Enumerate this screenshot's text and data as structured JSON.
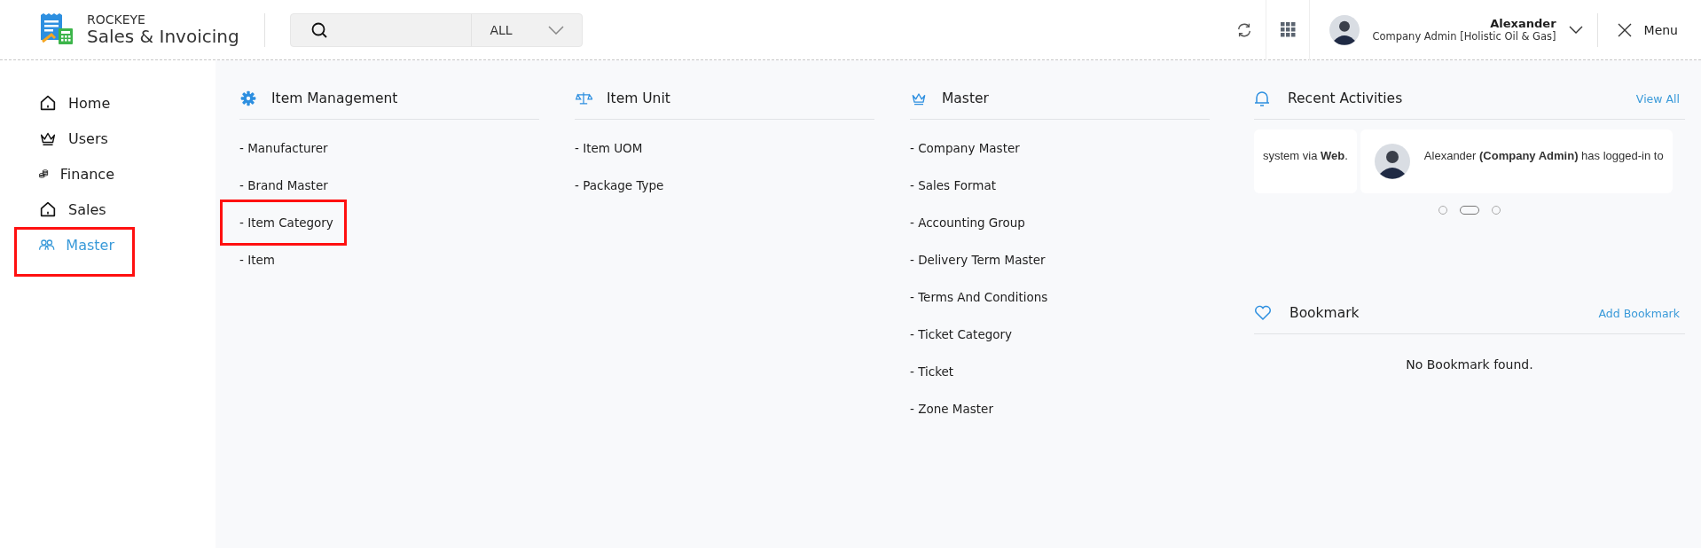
{
  "app": {
    "brand": "ROCKEYE",
    "title": "Sales & Invoicing"
  },
  "search": {
    "filter": "ALL"
  },
  "user": {
    "name": "Alexander",
    "role": "Company Admin [Holistic Oil & Gas]"
  },
  "menu_button": {
    "label": "Menu"
  },
  "sidebar": {
    "items": [
      {
        "label": "Home",
        "kind": "house",
        "selected": false,
        "highlighted": false
      },
      {
        "label": "Users",
        "kind": "crown",
        "selected": false,
        "highlighted": false
      },
      {
        "label": "Finance",
        "kind": "coins",
        "selected": false,
        "highlighted": false
      },
      {
        "label": "Sales",
        "kind": "house",
        "selected": false,
        "highlighted": false
      },
      {
        "label": "Master",
        "kind": "people",
        "selected": true,
        "highlighted": true
      }
    ]
  },
  "sections": [
    {
      "title": "Item Management",
      "kind": "gear",
      "links": [
        {
          "label": "- Manufacturer",
          "highlighted": false
        },
        {
          "label": "- Brand Master",
          "highlighted": false
        },
        {
          "label": "- Item Category",
          "highlighted": true
        },
        {
          "label": "- Item",
          "highlighted": false
        }
      ]
    },
    {
      "title": "Item Unit",
      "kind": "scale",
      "links": [
        {
          "label": "- Item UOM",
          "highlighted": false
        },
        {
          "label": "- Package Type",
          "highlighted": false
        }
      ]
    },
    {
      "title": "Master",
      "kind": "crown",
      "links": [
        {
          "label": "- Company Master",
          "highlighted": false
        },
        {
          "label": "- Sales Format",
          "highlighted": false
        },
        {
          "label": "- Accounting Group",
          "highlighted": false
        },
        {
          "label": "- Delivery Term Master",
          "highlighted": false
        },
        {
          "label": "- Terms And Conditions",
          "highlighted": false
        },
        {
          "label": "- Ticket Category",
          "highlighted": false
        },
        {
          "label": "- Ticket",
          "highlighted": false
        },
        {
          "label": "- Zone Master",
          "highlighted": false
        }
      ]
    }
  ],
  "recent_activities": {
    "title": "Recent Activities",
    "action": "View All",
    "cards": [
      {
        "text": "system via **Web**.",
        "avatar": false
      },
      {
        "text": "Alexander **(Company Admin)** has logged-in to",
        "avatar": true
      }
    ],
    "dots": [
      {
        "selected": false
      },
      {
        "selected": true
      },
      {
        "selected": false
      }
    ]
  },
  "bookmark": {
    "title": "Bookmark",
    "action": "Add Bookmark",
    "empty_text": "No Bookmark found."
  }
}
